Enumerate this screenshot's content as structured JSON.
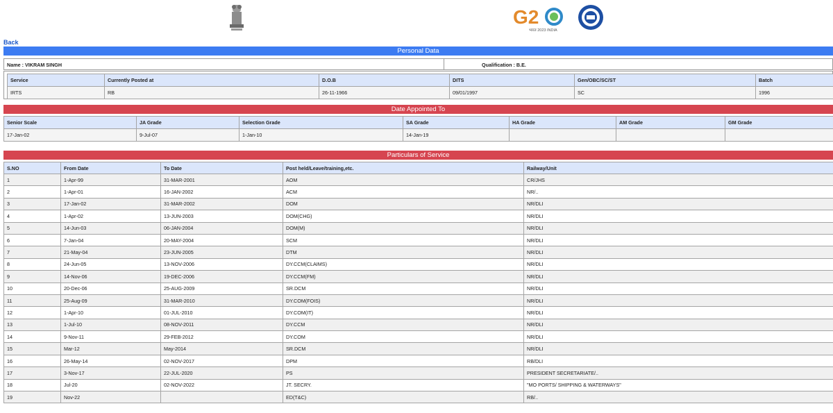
{
  "nav": {
    "back_label": "Back"
  },
  "logos": {
    "emblem": "national-emblem",
    "g20": "G20",
    "g20_sub": "भारत 2023 INDIA",
    "railway": "indian-railways-logo"
  },
  "personal": {
    "band_title": "Personal Data",
    "name": "Name : VIKRAM SINGH",
    "qualification": "Qualification : B.E.",
    "headers": [
      "Service",
      "Currently Posted at",
      "D.O.B",
      "DITS",
      "Gen/OBC/SC/ST",
      "Batch"
    ],
    "values": [
      "IRTS",
      "RB",
      "26-11-1966",
      "09/01/1997",
      "SC",
      "1996"
    ]
  },
  "dates": {
    "band_title": "Date Appointed To",
    "headers": [
      "Senior Scale",
      "JA Grade",
      "Selection Grade",
      "SA Grade",
      "HA Grade",
      "AM Grade",
      "GM Grade"
    ],
    "values": [
      "17-Jan-02",
      "9-Jul-07",
      "1-Jan-10",
      "14-Jan-19",
      "",
      "",
      ""
    ]
  },
  "service": {
    "band_title": "Particulars of Service",
    "headers": [
      "S.NO",
      "From Date",
      "To Date",
      "Post held/Leave/training,etc.",
      "Railway/Unit"
    ],
    "rows": [
      [
        "1",
        "1-Apr-99",
        "31-MAR-2001",
        "AOM",
        "CR/JHS"
      ],
      [
        "2",
        "1-Apr-01",
        "16-JAN-2002",
        "ACM",
        "NR/.."
      ],
      [
        "3",
        "17-Jan-02",
        "31-MAR-2002",
        "DOM",
        "NR/DLI"
      ],
      [
        "4",
        "1-Apr-02",
        "13-JUN-2003",
        "DOM(CHG)",
        "NR/DLI"
      ],
      [
        "5",
        "14-Jun-03",
        "06-JAN-2004",
        "DOM(M)",
        "NR/DLI"
      ],
      [
        "6",
        "7-Jan-04",
        "20-MAY-2004",
        "SCM",
        "NR/DLI"
      ],
      [
        "7",
        "21-May-04",
        "23-JUN-2005",
        "DTM",
        "NR/DLI"
      ],
      [
        "8",
        "24-Jun-05",
        "13-NOV-2006",
        "DY.CCM(CLAIMS)",
        "NR/DLI"
      ],
      [
        "9",
        "14-Nov-06",
        "19-DEC-2006",
        "DY.CCM(FM)",
        "NR/DLI"
      ],
      [
        "10",
        "20-Dec-06",
        "25-AUG-2009",
        "SR.DCM",
        "NR/DLI"
      ],
      [
        "11",
        "25-Aug-09",
        "31-MAR-2010",
        "DY.COM(FOIS)",
        "NR/DLI"
      ],
      [
        "12",
        "1-Apr-10",
        "01-JUL-2010",
        "DY.COM(IT)",
        "NR/DLI"
      ],
      [
        "13",
        "1-Jul-10",
        "08-NOV-2011",
        "DY.CCM",
        "NR/DLI"
      ],
      [
        "14",
        "9-Nov-11",
        "29-FEB-2012",
        "DY.COM",
        "NR/DLI"
      ],
      [
        "15",
        "Mar-12",
        "May-2014",
        "SR.DCM",
        "NR/DLI"
      ],
      [
        "16",
        "26-May-14",
        "02-NOV-2017",
        "DPM",
        "RB/DLI"
      ],
      [
        "17",
        "3-Nov-17",
        "22-JUL-2020",
        "PS",
        "PRESIDENT SECRETARIATE/.."
      ],
      [
        "18",
        "Jul-20",
        "02-NOV-2022",
        "JT. SECRY.",
        "\"MO PORTS/ SHIPPING & WATERWAYS\""
      ],
      [
        "19",
        "Nov-22",
        "",
        "ED(T&C)",
        "RB/.."
      ]
    ]
  },
  "colors": {
    "blue_band": "#3d7cf2",
    "red_band": "#d64550",
    "header_bg": "#dbe6fb",
    "link": "#1a56c8"
  }
}
